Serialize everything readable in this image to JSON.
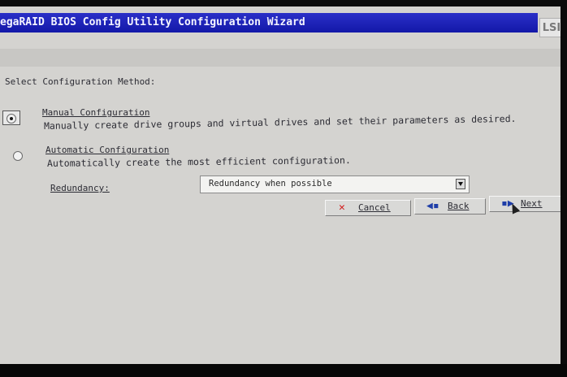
{
  "window": {
    "title": "egaRAID BIOS Config Utility Configuration Wizard",
    "logo_text": "LSI"
  },
  "prompt": "Select Configuration Method:",
  "options": [
    {
      "title": "Manual Configuration",
      "description": "Manually create drive groups and virtual drives and set their parameters as desired.",
      "selected": true
    },
    {
      "title": "Automatic Configuration",
      "description": "Automatically create the most efficient configuration.",
      "selected": false
    }
  ],
  "redundancy": {
    "label": "Redundancy:",
    "value": "Redundancy when possible"
  },
  "buttons": {
    "cancel": "Cancel",
    "back": "Back",
    "next": "Next"
  },
  "icons": {
    "cancel": "close-x-icon",
    "back": "arrow-left-icon",
    "next": "arrow-right-icon",
    "dropdown": "chevron-down-icon",
    "cursor": "mouse-cursor-icon"
  },
  "colors": {
    "title_bar": "#1318a8",
    "screen_bg": "#d4d3d0",
    "cancel_icon": "#d21a1a",
    "nav_icon": "#1f3ea8"
  }
}
